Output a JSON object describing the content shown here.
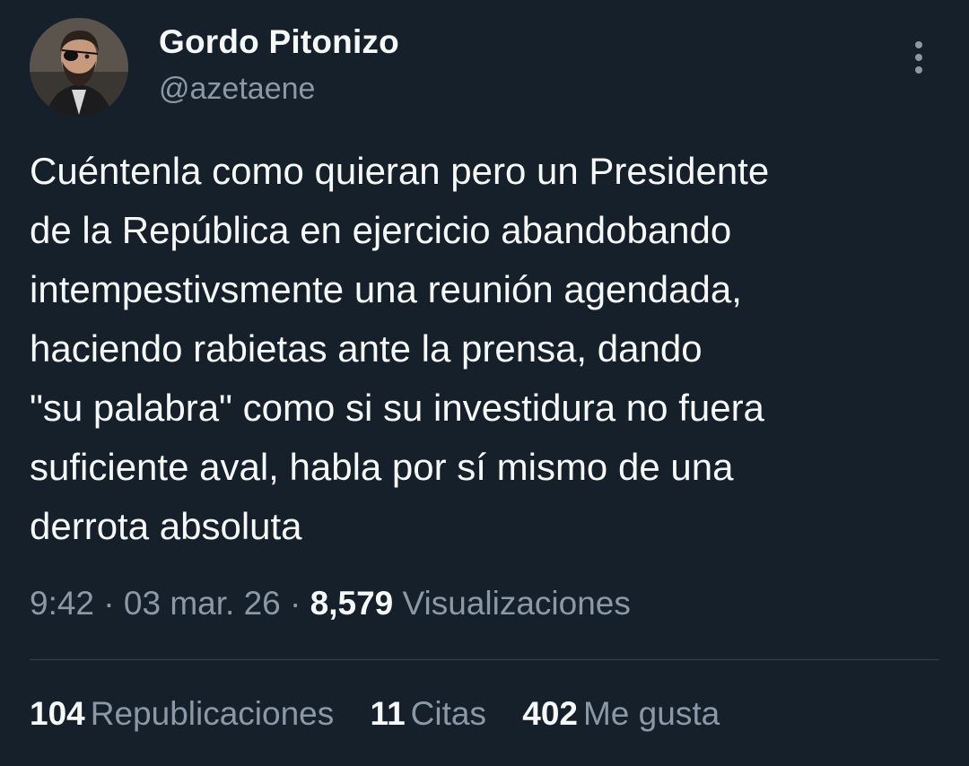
{
  "author": {
    "display_name": "Gordo Pitonizo",
    "handle": "@azetaene",
    "avatar_icon": "profile-photo"
  },
  "tweet": {
    "text": "Cuéntenla como quieran pero un Presidente\nde la República en ejercicio abandobando\nintempestivsmente una reunión agendada,\nhaciendo rabietas ante la prensa, dando\n\"su palabra\" como si su investidura no fuera\nsuficiente aval, habla por sí mismo de una\nderrota absoluta",
    "time": "9:42",
    "separator": "·",
    "date": "03 mar. 26",
    "views_count": "8,579",
    "views_label": "Visualizaciones"
  },
  "stats": {
    "reposts_count": "104",
    "reposts_label": "Republicaciones",
    "quotes_count": "11",
    "quotes_label": "Citas",
    "likes_count": "402",
    "likes_label": "Me gusta"
  },
  "colors": {
    "background": "#15202b",
    "primary_text": "#f7f9f9",
    "secondary_text": "#8b98a5",
    "divider": "#38444d"
  }
}
